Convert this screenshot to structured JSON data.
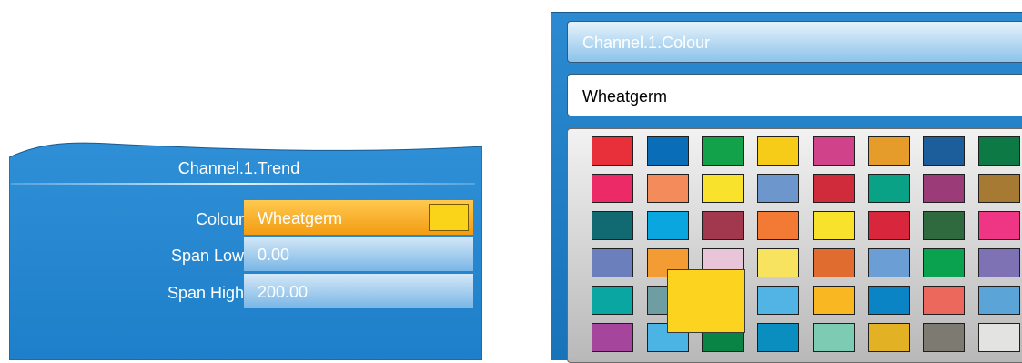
{
  "trend_panel": {
    "title": "Channel.1.Trend",
    "rows": [
      {
        "label": "Colour",
        "value": "Wheatgerm",
        "swatch": "#f9d418"
      },
      {
        "label": "Span Low",
        "value": "0.00"
      },
      {
        "label": "Span High",
        "value": "200.00"
      }
    ]
  },
  "picker": {
    "title": "Channel.1.Colour",
    "selected_name": "Wheatgerm",
    "selected_color": "#fcd31f",
    "grid_rows": [
      [
        "#e8303a",
        "#0a6db8",
        "#12a24a",
        "#f7cc18",
        "#d0428a",
        "#e59c2a",
        "#1c5d9c",
        "#0d7a45"
      ],
      [
        "#ec2a68",
        "#f38c5a",
        "#f9e22c",
        "#6d97cc",
        "#d02b3b",
        "#0aa286",
        "#9b3c78",
        "#a77a34"
      ],
      [
        "#116a72",
        "#0aa6e0",
        "#a1384e",
        "#f27a34",
        "#f9e22c",
        "#d8263d",
        "#2e6a3e",
        "#ee3684"
      ],
      [
        "#6c7fbd",
        "#f39c34",
        "#e8c5d8",
        "#f7e35f",
        "#e06c30",
        "#6a9ed4",
        "#0aa24e",
        "#7e72b4"
      ],
      [
        "#0aa6a2",
        "#6e9ea2",
        "#e45a8c",
        "#52b4e4",
        "#f9b822",
        "#0a84c4",
        "#ec675c",
        "#5ba4d8"
      ],
      [
        "#a5469c",
        "#4cb4e4",
        "#0a8444",
        "#0a8ec0",
        "#7ccbb2",
        "#e2b224",
        "#7d7a72",
        "#e3e3e1"
      ]
    ]
  }
}
